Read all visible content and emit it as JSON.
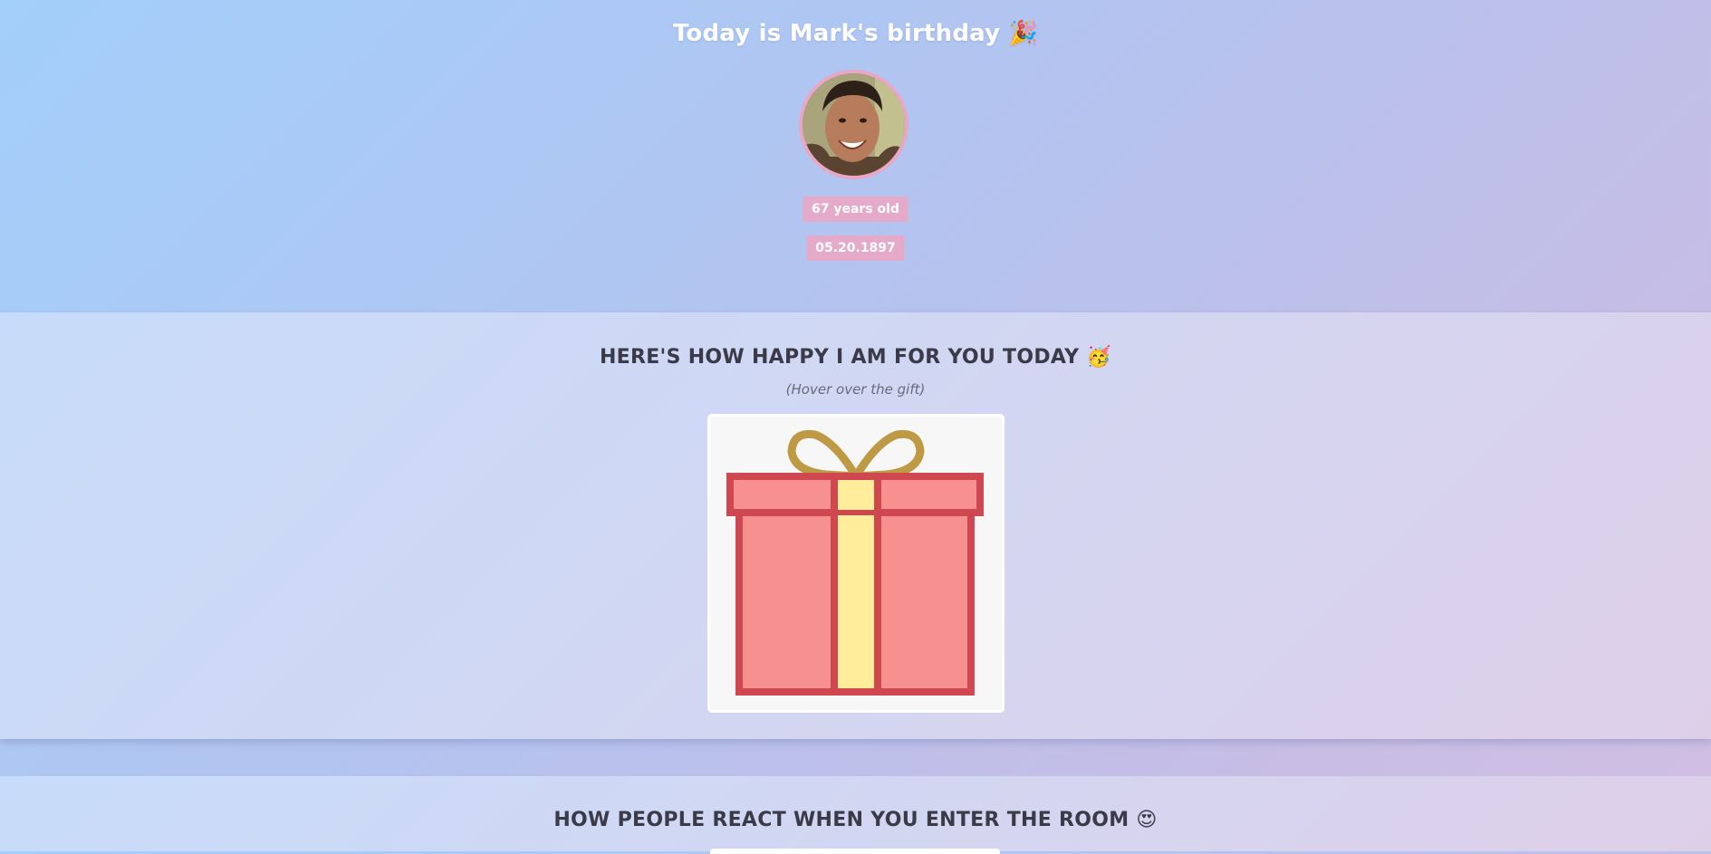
{
  "hero": {
    "title": "Today is Mark's birthday 🎉",
    "age": "67 years old",
    "date": "05.20.1897"
  },
  "gift_section": {
    "title": "HERE'S HOW HAPPY I AM FOR YOU TODAY 🥳",
    "hint": "(Hover over the gift)"
  },
  "react_section": {
    "title": "HOW PEOPLE REACT WHEN YOU ENTER THE ROOM 😍"
  },
  "colors": {
    "box": "#f7918f",
    "box_outline": "#d0484f",
    "ribbon": "#ffed9c",
    "bow": "#bf9a45",
    "badge": "#e5a9c9"
  }
}
